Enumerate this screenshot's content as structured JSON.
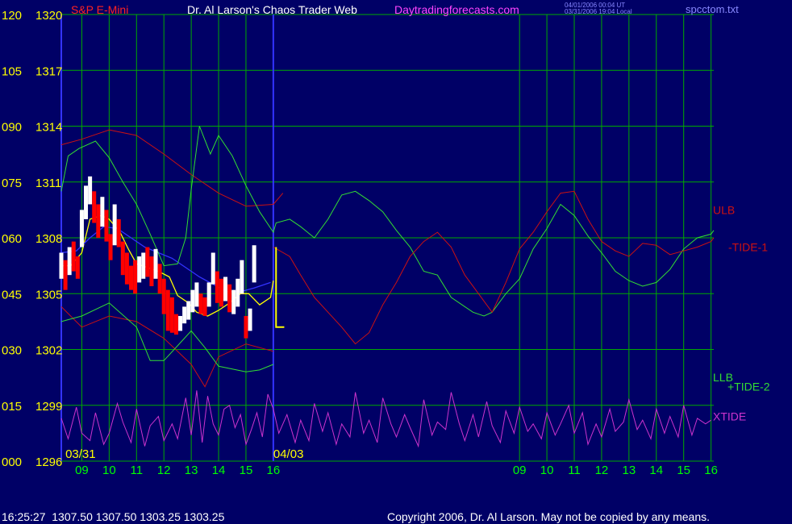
{
  "header": {
    "symbol_title": "S&P E-Mini",
    "author_title": "Dr. Al Larson's Chaos Trader Web",
    "site": "Daytradingforecasts.com",
    "timestamp_ut": "04/01/2006 00:04 UT",
    "timestamp_local": "03/31/2006 19:04 Local",
    "file_name": "spcctom.txt"
  },
  "footer": {
    "quote": "16:25:27  1307.50 1307.50 1303.25 1303.25",
    "copyright": "Copyright 2006, Dr. Al Larson. May not be copied by any means."
  },
  "colors": {
    "background": "#000066",
    "grid": "#00aa00",
    "axis_price": "#ffff00",
    "axis_time": "#00ff00",
    "title_symbol": "#ff2222",
    "title_author": "#ffffff",
    "site": "#ff44ff",
    "file": "#8888ff",
    "price_down": "#ff0000",
    "price_up": "#ffffff",
    "moving_avg_fast": "#ffff00",
    "moving_avg_slow": "#3333ff",
    "bands": "#cc1111",
    "tide_green": "#33dd33",
    "tide_red": "#cc1111",
    "xtide": "#cc33cc",
    "divider": "#3333ff"
  },
  "chart_data": {
    "type": "line",
    "y_left_osc_ticks": [
      "120",
      "105",
      "090",
      "075",
      "060",
      "045",
      "030",
      "015",
      "000"
    ],
    "y_left_price_ticks": [
      "1320",
      "1317",
      "1314",
      "1311",
      "1308",
      "1305",
      "1302",
      "1299",
      "1296"
    ],
    "ylim_price": [
      1296,
      1320
    ],
    "ylim_osc": [
      0,
      120
    ],
    "x_ticks": [
      "09",
      "10",
      "11",
      "12",
      "13",
      "14",
      "15",
      "16",
      "09",
      "10",
      "11",
      "12",
      "13",
      "14",
      "15",
      "16"
    ],
    "x_hours": [
      9,
      10,
      11,
      12,
      13,
      14,
      15,
      16,
      25,
      26,
      27,
      28,
      29,
      30,
      31,
      32
    ],
    "xlim": [
      8.25,
      32.1
    ],
    "date_labels": [
      {
        "text": "03/31",
        "x": 8.4
      },
      {
        "text": "04/03",
        "x": 16.0
      }
    ],
    "divider_x": 16.0,
    "grid": true,
    "series_labels": [
      {
        "name": "ULB",
        "color": "#cc1111",
        "y": 1309.5
      },
      {
        "name": "-TIDE-1",
        "color": "#cc1111",
        "y": 1307.5
      },
      {
        "name": "LLB",
        "color": "#33dd33",
        "y": 1300.5
      },
      {
        "name": "+TIDE-2",
        "color": "#33dd33",
        "y": 1300.0
      },
      {
        "name": "XTIDE",
        "color": "#cc33cc",
        "y": 1298.4
      }
    ],
    "forecast_marker": {
      "x": [
        16.1,
        16.4
      ],
      "y_top": 1307.5,
      "y_bottom": 1303.2
    },
    "price_bars": {
      "x": [
        8.25,
        8.4,
        8.55,
        8.7,
        8.85,
        9.0,
        9.15,
        9.3,
        9.45,
        9.6,
        9.75,
        9.9,
        10.05,
        10.2,
        10.35,
        10.5,
        10.65,
        10.8,
        10.95,
        11.1,
        11.25,
        11.4,
        11.55,
        11.7,
        11.85,
        12.0,
        12.15,
        12.3,
        12.45,
        12.6,
        12.75,
        12.9,
        13.05,
        13.2,
        13.35,
        13.5,
        13.65,
        13.8,
        13.95,
        14.1,
        14.25,
        14.4,
        14.55,
        14.7,
        14.85,
        15.0,
        15.15,
        15.3,
        15.45,
        15.6,
        15.75,
        15.9
      ],
      "high": [
        1307.2,
        1306.8,
        1307.5,
        1307.8,
        1307.0,
        1309.5,
        1310.8,
        1311.3,
        1310.5,
        1309.8,
        1310.2,
        1309.5,
        1308.2,
        1309.8,
        1309.0,
        1307.8,
        1307.2,
        1306.5,
        1306.8,
        1307.0,
        1307.2,
        1307.5,
        1307.0,
        1307.4,
        1306.6,
        1305.8,
        1305.2,
        1304.8,
        1303.9,
        1303.8,
        1304.3,
        1304.6,
        1305.2,
        1305.6,
        1305.0,
        1304.8,
        1305.6,
        1307.2,
        1306.2,
        1305.8,
        1305.9,
        1305.5,
        1305.2,
        1305.8,
        1306.8,
        1303.8,
        1304.2,
        1307.6
      ],
      "low": [
        1305.8,
        1305.2,
        1306.0,
        1306.2,
        1305.8,
        1307.5,
        1309.0,
        1309.8,
        1308.8,
        1308.0,
        1308.6,
        1307.8,
        1306.8,
        1307.6,
        1307.5,
        1306.0,
        1305.5,
        1305.2,
        1305.0,
        1305.6,
        1305.8,
        1305.9,
        1305.4,
        1305.8,
        1305.0,
        1303.9,
        1303.0,
        1302.9,
        1302.8,
        1303.0,
        1303.4,
        1303.6,
        1304.0,
        1304.3,
        1303.9,
        1303.8,
        1304.3,
        1305.5,
        1304.5,
        1304.3,
        1304.6,
        1304.0,
        1303.9,
        1304.3,
        1305.0,
        1302.6,
        1303.0,
        1305.6
      ],
      "close": [
        1306.5,
        1306.0,
        1307.0,
        1307.0,
        1306.5,
        1309.0,
        1310.0,
        1310.5,
        1309.5,
        1309.0,
        1309.5,
        1308.5,
        1307.5,
        1308.8,
        1308.0,
        1306.8,
        1306.2,
        1306.0,
        1305.8,
        1306.5,
        1306.8,
        1306.8,
        1306.0,
        1306.8,
        1305.7,
        1304.5,
        1303.5,
        1303.3,
        1303.3,
        1303.5,
        1304.0,
        1304.2,
        1304.8,
        1304.9,
        1304.3,
        1304.2,
        1305.0,
        1306.5,
        1305.2,
        1305.0,
        1305.3,
        1304.5,
        1304.5,
        1305.2,
        1306.3,
        1303.2,
        1303.6,
        1307.2
      ],
      "open": [
        1306.0,
        1306.5,
        1306.2,
        1307.1,
        1306.9,
        1307.6,
        1309.1,
        1310.0,
        1310.3,
        1309.4,
        1308.8,
        1309.3,
        1308.0,
        1307.9,
        1308.8,
        1307.6,
        1306.9,
        1306.3,
        1306.4,
        1305.8,
        1306.4,
        1306.9,
        1306.9,
        1306.0,
        1306.4,
        1305.6,
        1304.6,
        1303.6,
        1303.5,
        1303.4,
        1303.5,
        1304.0,
        1304.1,
        1304.7,
        1304.9,
        1304.5,
        1304.4,
        1305.6,
        1306.0,
        1305.4,
        1305.0,
        1305.4,
        1304.4,
        1304.4,
        1305.1,
        1305.9,
        1303.4,
        1305.9
      ]
    },
    "series": [
      {
        "name": "moving_avg_fast",
        "color": "#ffff00",
        "x": [
          8.25,
          8.6,
          9.0,
          9.3,
          9.7,
          10.0,
          10.4,
          10.7,
          11.0,
          11.4,
          11.8,
          12.2,
          12.5,
          12.9,
          13.2,
          13.6,
          14.0,
          14.4,
          14.8,
          15.1,
          15.5,
          15.9,
          16.0
        ],
        "y": [
          1306.5,
          1306.5,
          1307.2,
          1309.0,
          1309.2,
          1309.0,
          1308.3,
          1307.4,
          1306.6,
          1306.4,
          1306.2,
          1305.9,
          1304.9,
          1304.5,
          1304.0,
          1303.8,
          1304.1,
          1304.5,
          1305.0,
          1305.0,
          1304.4,
          1304.8,
          1305.7
        ]
      },
      {
        "name": "moving_avg_slow",
        "color": "#3333ff",
        "x": [
          8.25,
          8.8,
          9.3,
          9.8,
          10.3,
          10.8,
          11.3,
          11.8,
          12.3,
          12.8,
          13.3,
          13.8,
          14.3,
          14.8,
          15.3,
          15.9
        ],
        "y": [
          1307.2,
          1307.3,
          1308.0,
          1308.6,
          1308.5,
          1308.0,
          1307.5,
          1307.2,
          1306.9,
          1306.4,
          1305.9,
          1305.5,
          1305.1,
          1305.1,
          1305.3,
          1305.6
        ]
      },
      {
        "name": "upper_band",
        "color": "#cc1111",
        "x": [
          8.25,
          9.0,
          10.0,
          11.0,
          12.0,
          13.0,
          14.0,
          15.0,
          16.0,
          16.35
        ],
        "y": [
          1313.0,
          1313.3,
          1313.8,
          1313.5,
          1312.5,
          1311.4,
          1310.4,
          1309.7,
          1309.8,
          1310.4
        ]
      },
      {
        "name": "lower_band",
        "color": "#cc1111",
        "x": [
          8.25,
          9.0,
          10.0,
          11.0,
          12.0,
          13.0,
          13.5,
          14.0,
          15.0,
          16.0
        ],
        "y": [
          1304.3,
          1303.2,
          1303.8,
          1303.5,
          1302.6,
          1301.2,
          1300.0,
          1301.6,
          1302.3,
          1301.9
        ]
      },
      {
        "name": "+TIDE-2",
        "color": "#33dd33",
        "x": [
          8.25,
          8.5,
          8.9,
          9.5,
          10.0,
          10.5,
          11.0,
          11.5,
          12.0,
          12.5,
          12.8,
          13.0,
          13.3,
          13.7,
          14.0,
          14.5,
          15.0,
          15.5,
          16.0,
          16.1,
          16.6,
          17.0,
          17.5,
          18.0,
          18.5,
          19.0,
          19.5,
          20.0,
          20.5,
          21.0,
          21.5,
          22.0,
          22.5,
          23.0,
          23.3,
          23.7,
          24.0,
          24.3,
          24.5,
          25.0,
          25.5,
          26.0,
          26.5,
          27.0,
          27.5,
          28.0,
          28.5,
          29.0,
          29.5,
          30.0,
          30.5,
          31.0,
          31.5,
          32.0,
          32.1
        ],
        "y": [
          1310.5,
          1312.4,
          1312.8,
          1313.2,
          1312.3,
          1311.0,
          1309.8,
          1308.2,
          1306.5,
          1306.6,
          1308.0,
          1310.6,
          1314.0,
          1312.5,
          1313.5,
          1312.4,
          1310.8,
          1309.4,
          1308.3,
          1308.8,
          1309.0,
          1308.6,
          1308.0,
          1309.0,
          1310.3,
          1310.5,
          1310.0,
          1309.4,
          1308.4,
          1307.5,
          1306.2,
          1306.0,
          1304.8,
          1304.3,
          1304.0,
          1303.8,
          1304.0,
          1304.6,
          1305.0,
          1305.8,
          1307.4,
          1308.5,
          1309.8,
          1309.2,
          1308.1,
          1307.2,
          1306.2,
          1305.7,
          1305.4,
          1305.6,
          1306.3,
          1307.4,
          1308.0,
          1308.2,
          1308.4
        ]
      },
      {
        "name": "-TIDE-1",
        "color": "#cc1111",
        "x": [
          16.0,
          16.6,
          17.0,
          17.5,
          18.0,
          18.5,
          19.0,
          19.5,
          20.0,
          20.5,
          21.0,
          21.5,
          22.0,
          22.5,
          23.0,
          23.5,
          24.0,
          24.5,
          25.0,
          25.5,
          26.0,
          26.5,
          27.0,
          27.5,
          28.0,
          28.5,
          29.0,
          29.5,
          30.0,
          30.5,
          31.0,
          31.5,
          32.0,
          32.1
        ],
        "y": [
          1307.5,
          1307.0,
          1306.0,
          1304.8,
          1304.0,
          1303.2,
          1302.3,
          1302.9,
          1304.4,
          1305.6,
          1307.0,
          1307.8,
          1308.3,
          1307.5,
          1306.0,
          1305.0,
          1304.0,
          1305.6,
          1307.4,
          1308.3,
          1309.4,
          1310.4,
          1310.5,
          1309.0,
          1307.8,
          1307.3,
          1307.0,
          1307.7,
          1307.6,
          1307.1,
          1307.3,
          1307.5,
          1307.8,
          1308.0
        ]
      },
      {
        "name": "green_low_line",
        "color": "#33dd33",
        "x": [
          8.25,
          9.0,
          10.0,
          11.0,
          11.5,
          12.0,
          12.5,
          13.0,
          13.5,
          14.0,
          15.0,
          15.5,
          16.0
        ],
        "y": [
          1303.5,
          1303.8,
          1304.5,
          1303.2,
          1301.4,
          1301.4,
          1302.2,
          1303.0,
          1302.1,
          1301.1,
          1300.8,
          1300.9,
          1301.2
        ]
      },
      {
        "name": "XTIDE",
        "color": "#cc33cc",
        "x": [
          8.25,
          8.5,
          8.8,
          9.0,
          9.3,
          9.5,
          9.8,
          10.0,
          10.3,
          10.5,
          10.8,
          11.0,
          11.3,
          11.5,
          11.8,
          12.0,
          12.3,
          12.5,
          12.8,
          13.0,
          13.2,
          13.4,
          13.6,
          13.8,
          14.0,
          14.2,
          14.4,
          14.6,
          14.8,
          15.0,
          15.2,
          15.4,
          15.6,
          15.8,
          16.0,
          16.2,
          16.5,
          16.8,
          17.0,
          17.3,
          17.5,
          17.8,
          18.0,
          18.3,
          18.5,
          18.8,
          19.0,
          19.3,
          19.5,
          19.8,
          20.0,
          20.3,
          20.5,
          20.8,
          21.0,
          21.3,
          21.5,
          21.8,
          22.0,
          22.3,
          22.5,
          22.8,
          23.0,
          23.3,
          23.5,
          23.8,
          24.0,
          24.3,
          24.5,
          24.8,
          25.0,
          25.3,
          25.5,
          25.8,
          26.0,
          26.3,
          26.5,
          26.8,
          27.0,
          27.3,
          27.5,
          27.8,
          28.0,
          28.3,
          28.5,
          28.8,
          29.0,
          29.3,
          29.5,
          29.8,
          30.0,
          30.3,
          30.5,
          30.8,
          31.0,
          31.3,
          31.5,
          31.8,
          32.0
        ],
        "y": [
          1298.3,
          1297.2,
          1298.9,
          1297.5,
          1297.1,
          1298.6,
          1296.9,
          1297.5,
          1299.1,
          1298.1,
          1297.0,
          1298.8,
          1296.8,
          1297.9,
          1298.4,
          1297.1,
          1298.0,
          1297.2,
          1299.4,
          1297.4,
          1299.8,
          1297.0,
          1299.5,
          1298.0,
          1297.4,
          1298.8,
          1299.0,
          1297.8,
          1298.5,
          1296.9,
          1297.7,
          1298.6,
          1297.3,
          1299.6,
          1298.8,
          1297.5,
          1298.5,
          1297.0,
          1298.2,
          1297.1,
          1299.1,
          1297.6,
          1298.6,
          1296.9,
          1298.0,
          1297.3,
          1299.7,
          1297.5,
          1298.2,
          1297.0,
          1299.4,
          1298.0,
          1297.3,
          1298.5,
          1297.8,
          1296.8,
          1299.3,
          1297.4,
          1298.1,
          1297.7,
          1299.7,
          1298.0,
          1297.1,
          1298.5,
          1297.3,
          1299.2,
          1297.9,
          1297.0,
          1298.7,
          1297.5,
          1298.9,
          1297.6,
          1298.0,
          1297.2,
          1298.6,
          1297.4,
          1298.0,
          1299.0,
          1297.5,
          1298.6,
          1296.9,
          1298.0,
          1297.3,
          1298.8,
          1297.6,
          1298.1,
          1299.3,
          1297.7,
          1298.2,
          1297.2,
          1298.8,
          1297.5,
          1298.4,
          1297.3,
          1299.0,
          1297.4,
          1298.3,
          1298.0,
          1298.2
        ]
      }
    ]
  }
}
